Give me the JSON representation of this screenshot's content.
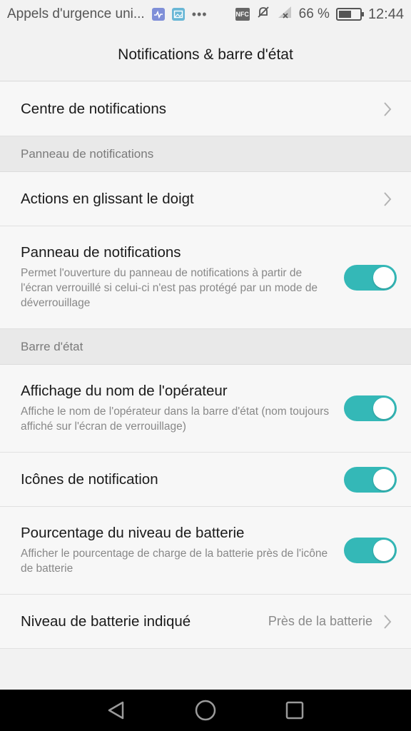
{
  "status_bar": {
    "carrier": "Appels d'urgence uni...",
    "nfc_label": "NFC",
    "battery_percent": "66 %",
    "battery_level": 0.66,
    "time": "12:44",
    "icons": [
      "health-notification-icon",
      "gallery-notification-icon",
      "more-dots-icon",
      "nfc-icon",
      "mute-icon",
      "signal-icon",
      "battery-icon"
    ]
  },
  "header": {
    "title": "Notifications & barre d'état"
  },
  "items": {
    "notification_center": {
      "title": "Centre de notifications"
    },
    "section_panel": {
      "label": "Panneau de notifications"
    },
    "swipe_actions": {
      "title": "Actions en glissant le doigt"
    },
    "notification_panel": {
      "title": "Panneau de notifications",
      "summary": "Permet l'ouverture du panneau de notifications à partir de l'écran verrouillé si celui-ci n'est pas protégé par un mode de déverrouillage",
      "enabled": true
    },
    "section_status_bar": {
      "label": "Barre d'état"
    },
    "carrier_name": {
      "title": "Affichage du nom de l'opérateur",
      "summary": "Affiche le nom de l'opérateur dans la barre d'état (nom toujours affiché sur l'écran de verrouillage)",
      "enabled": true
    },
    "notification_icons": {
      "title": "Icônes de notification",
      "enabled": true
    },
    "battery_percentage": {
      "title": "Pourcentage du niveau de batterie",
      "summary": "Afficher le pourcentage de charge de la batterie près de l'icône de batterie",
      "enabled": true
    },
    "battery_level_display": {
      "title": "Niveau de batterie indiqué",
      "value": "Près de la batterie"
    }
  },
  "colors": {
    "toggle_on": "#34b8b7",
    "background": "#f2f2f2",
    "section_background": "#e9e9e9",
    "nav_bar": "#000000"
  }
}
